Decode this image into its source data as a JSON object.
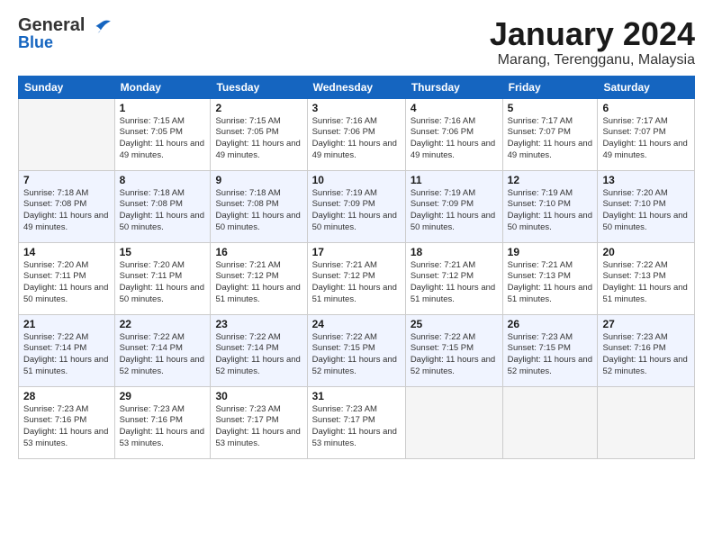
{
  "logo": {
    "line1a": "General",
    "line1b": "Blue"
  },
  "title": "January 2024",
  "location": "Marang, Terengganu, Malaysia",
  "weekdays": [
    "Sunday",
    "Monday",
    "Tuesday",
    "Wednesday",
    "Thursday",
    "Friday",
    "Saturday"
  ],
  "weeks": [
    [
      {
        "day": "",
        "sunrise": "",
        "sunset": "",
        "daylight": ""
      },
      {
        "day": "1",
        "sunrise": "Sunrise: 7:15 AM",
        "sunset": "Sunset: 7:05 PM",
        "daylight": "Daylight: 11 hours and 49 minutes."
      },
      {
        "day": "2",
        "sunrise": "Sunrise: 7:15 AM",
        "sunset": "Sunset: 7:05 PM",
        "daylight": "Daylight: 11 hours and 49 minutes."
      },
      {
        "day": "3",
        "sunrise": "Sunrise: 7:16 AM",
        "sunset": "Sunset: 7:06 PM",
        "daylight": "Daylight: 11 hours and 49 minutes."
      },
      {
        "day": "4",
        "sunrise": "Sunrise: 7:16 AM",
        "sunset": "Sunset: 7:06 PM",
        "daylight": "Daylight: 11 hours and 49 minutes."
      },
      {
        "day": "5",
        "sunrise": "Sunrise: 7:17 AM",
        "sunset": "Sunset: 7:07 PM",
        "daylight": "Daylight: 11 hours and 49 minutes."
      },
      {
        "day": "6",
        "sunrise": "Sunrise: 7:17 AM",
        "sunset": "Sunset: 7:07 PM",
        "daylight": "Daylight: 11 hours and 49 minutes."
      }
    ],
    [
      {
        "day": "7",
        "sunrise": "Sunrise: 7:18 AM",
        "sunset": "Sunset: 7:08 PM",
        "daylight": "Daylight: 11 hours and 49 minutes."
      },
      {
        "day": "8",
        "sunrise": "Sunrise: 7:18 AM",
        "sunset": "Sunset: 7:08 PM",
        "daylight": "Daylight: 11 hours and 50 minutes."
      },
      {
        "day": "9",
        "sunrise": "Sunrise: 7:18 AM",
        "sunset": "Sunset: 7:08 PM",
        "daylight": "Daylight: 11 hours and 50 minutes."
      },
      {
        "day": "10",
        "sunrise": "Sunrise: 7:19 AM",
        "sunset": "Sunset: 7:09 PM",
        "daylight": "Daylight: 11 hours and 50 minutes."
      },
      {
        "day": "11",
        "sunrise": "Sunrise: 7:19 AM",
        "sunset": "Sunset: 7:09 PM",
        "daylight": "Daylight: 11 hours and 50 minutes."
      },
      {
        "day": "12",
        "sunrise": "Sunrise: 7:19 AM",
        "sunset": "Sunset: 7:10 PM",
        "daylight": "Daylight: 11 hours and 50 minutes."
      },
      {
        "day": "13",
        "sunrise": "Sunrise: 7:20 AM",
        "sunset": "Sunset: 7:10 PM",
        "daylight": "Daylight: 11 hours and 50 minutes."
      }
    ],
    [
      {
        "day": "14",
        "sunrise": "Sunrise: 7:20 AM",
        "sunset": "Sunset: 7:11 PM",
        "daylight": "Daylight: 11 hours and 50 minutes."
      },
      {
        "day": "15",
        "sunrise": "Sunrise: 7:20 AM",
        "sunset": "Sunset: 7:11 PM",
        "daylight": "Daylight: 11 hours and 50 minutes."
      },
      {
        "day": "16",
        "sunrise": "Sunrise: 7:21 AM",
        "sunset": "Sunset: 7:12 PM",
        "daylight": "Daylight: 11 hours and 51 minutes."
      },
      {
        "day": "17",
        "sunrise": "Sunrise: 7:21 AM",
        "sunset": "Sunset: 7:12 PM",
        "daylight": "Daylight: 11 hours and 51 minutes."
      },
      {
        "day": "18",
        "sunrise": "Sunrise: 7:21 AM",
        "sunset": "Sunset: 7:12 PM",
        "daylight": "Daylight: 11 hours and 51 minutes."
      },
      {
        "day": "19",
        "sunrise": "Sunrise: 7:21 AM",
        "sunset": "Sunset: 7:13 PM",
        "daylight": "Daylight: 11 hours and 51 minutes."
      },
      {
        "day": "20",
        "sunrise": "Sunrise: 7:22 AM",
        "sunset": "Sunset: 7:13 PM",
        "daylight": "Daylight: 11 hours and 51 minutes."
      }
    ],
    [
      {
        "day": "21",
        "sunrise": "Sunrise: 7:22 AM",
        "sunset": "Sunset: 7:14 PM",
        "daylight": "Daylight: 11 hours and 51 minutes."
      },
      {
        "day": "22",
        "sunrise": "Sunrise: 7:22 AM",
        "sunset": "Sunset: 7:14 PM",
        "daylight": "Daylight: 11 hours and 52 minutes."
      },
      {
        "day": "23",
        "sunrise": "Sunrise: 7:22 AM",
        "sunset": "Sunset: 7:14 PM",
        "daylight": "Daylight: 11 hours and 52 minutes."
      },
      {
        "day": "24",
        "sunrise": "Sunrise: 7:22 AM",
        "sunset": "Sunset: 7:15 PM",
        "daylight": "Daylight: 11 hours and 52 minutes."
      },
      {
        "day": "25",
        "sunrise": "Sunrise: 7:22 AM",
        "sunset": "Sunset: 7:15 PM",
        "daylight": "Daylight: 11 hours and 52 minutes."
      },
      {
        "day": "26",
        "sunrise": "Sunrise: 7:23 AM",
        "sunset": "Sunset: 7:15 PM",
        "daylight": "Daylight: 11 hours and 52 minutes."
      },
      {
        "day": "27",
        "sunrise": "Sunrise: 7:23 AM",
        "sunset": "Sunset: 7:16 PM",
        "daylight": "Daylight: 11 hours and 52 minutes."
      }
    ],
    [
      {
        "day": "28",
        "sunrise": "Sunrise: 7:23 AM",
        "sunset": "Sunset: 7:16 PM",
        "daylight": "Daylight: 11 hours and 53 minutes."
      },
      {
        "day": "29",
        "sunrise": "Sunrise: 7:23 AM",
        "sunset": "Sunset: 7:16 PM",
        "daylight": "Daylight: 11 hours and 53 minutes."
      },
      {
        "day": "30",
        "sunrise": "Sunrise: 7:23 AM",
        "sunset": "Sunset: 7:17 PM",
        "daylight": "Daylight: 11 hours and 53 minutes."
      },
      {
        "day": "31",
        "sunrise": "Sunrise: 7:23 AM",
        "sunset": "Sunset: 7:17 PM",
        "daylight": "Daylight: 11 hours and 53 minutes."
      },
      {
        "day": "",
        "sunrise": "",
        "sunset": "",
        "daylight": ""
      },
      {
        "day": "",
        "sunrise": "",
        "sunset": "",
        "daylight": ""
      },
      {
        "day": "",
        "sunrise": "",
        "sunset": "",
        "daylight": ""
      }
    ]
  ]
}
